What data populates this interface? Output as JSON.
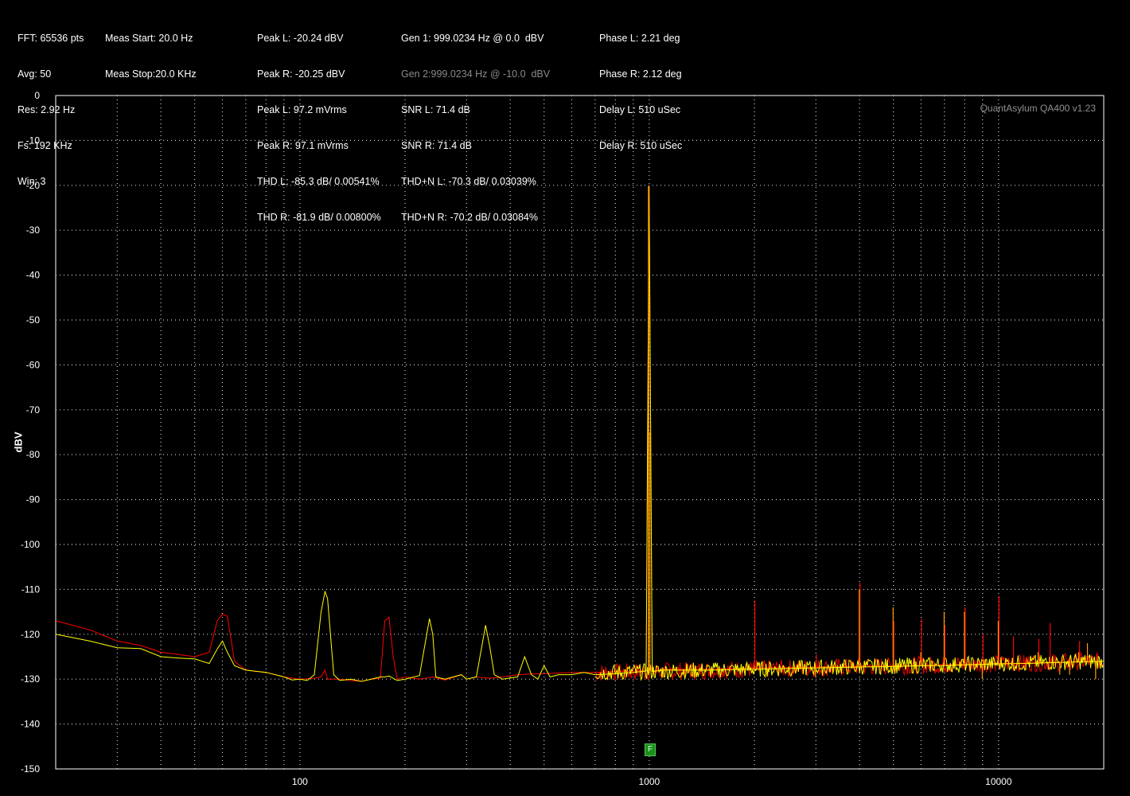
{
  "stats": {
    "col1": [
      "FFT: 65536 pts",
      "Avg: 50",
      "Res: 2.92 Hz",
      "Fs: 192 KHz",
      "Win: 3"
    ],
    "col2": [
      "Meas Start: 20.0 Hz",
      "Meas Stop:20.0 KHz"
    ],
    "col3": [
      "Peak L: -20.24 dBV",
      "Peak R: -20.25 dBV",
      "Peak L: 97.2 mVrms",
      "Peak R: 97.1 mVrms",
      "THD L: -85.3 dB/ 0.00541%",
      "THD R: -81.9 dB/ 0.00800%"
    ],
    "col4_gen1": "Gen 1: 999.0234 Hz @ 0.0  dBV",
    "col4_gen2": "Gen 2:999.0234 Hz @ -10.0  dBV",
    "col4": [
      "SNR L: 71.4 dB",
      "SNR R: 71.4 dB",
      "THD+N L: -70.3 dB/ 0.03039%",
      "THD+N R: -70.2 dB/ 0.03084%"
    ],
    "col5": [
      "Phase L: 2.21 deg",
      "Phase R: 2.12 deg",
      "Delay L: 510 uSec",
      "Delay R: 510 uSec"
    ]
  },
  "watermark": "QuantAsylum QA400 v1.23",
  "marker_label": "F",
  "colors": {
    "left": "#ffff00",
    "right": "#ff0000",
    "overlap": "#ff9d00",
    "grid": "#d0d0d0",
    "marker": "#1a8f1a"
  },
  "chart_data": {
    "type": "line",
    "x_scale": "log",
    "xlim": [
      20,
      20000
    ],
    "ylim": [
      -150,
      0
    ],
    "ylabel": "dBV",
    "xlabel": "",
    "x_ticks": [
      100,
      1000,
      10000
    ],
    "y_ticks": [
      0,
      -10,
      -20,
      -30,
      -40,
      -50,
      -60,
      -70,
      -80,
      -90,
      -100,
      -110,
      -120,
      -130,
      -140,
      -150
    ],
    "grid": true,
    "series": [
      {
        "name": "L",
        "color": "#ffff00",
        "x": [
          20,
          25,
          30,
          35,
          40,
          45,
          50,
          55,
          58,
          60,
          62,
          65,
          70,
          80,
          90,
          95,
          100,
          105,
          110,
          115,
          118,
          120,
          125,
          130,
          140,
          150,
          160,
          170,
          175,
          180,
          190,
          200,
          220,
          235,
          240,
          245,
          260,
          290,
          300,
          320,
          340,
          350,
          360,
          380,
          420,
          440,
          460,
          480,
          500,
          520,
          550,
          600,
          650,
          700,
          800,
          900,
          980,
          999,
          1020,
          1100,
          1500,
          2000,
          3000,
          4000,
          5000,
          6000,
          7000,
          8000,
          9000,
          10000,
          12000,
          15000,
          20000
        ],
        "y": [
          -120,
          -121.5,
          -123,
          -123.2,
          -125,
          -125.3,
          -125.5,
          -126.5,
          -123.3,
          -121.5,
          -124,
          -127,
          -128,
          -128.5,
          -129.5,
          -130.2,
          -130,
          -130.3,
          -129,
          -115,
          -110.5,
          -112,
          -129,
          -130.3,
          -130,
          -130.5,
          -130,
          -129.5,
          -129.5,
          -129.3,
          -130.3,
          -130,
          -129.2,
          -116.5,
          -120,
          -129.5,
          -130,
          -129,
          -130,
          -129.5,
          -118,
          -123,
          -129,
          -130,
          -129.5,
          -125,
          -129,
          -130,
          -127,
          -129.5,
          -129,
          -129,
          -128.5,
          -129,
          -128.8,
          -128.5,
          -128.2,
          -20.2,
          -128.3,
          -128,
          -128,
          -127.8,
          -127.5,
          -127.3,
          -127.2,
          -127,
          -127,
          -126.8,
          -126.7,
          -126.6,
          -126.5,
          -126.3,
          -126
        ]
      },
      {
        "name": "R",
        "color": "#ff0000",
        "x": [
          20,
          25,
          30,
          35,
          40,
          45,
          50,
          55,
          58,
          60,
          62,
          65,
          70,
          80,
          90,
          100,
          110,
          115,
          118,
          120,
          130,
          140,
          150,
          160,
          170,
          175,
          180,
          185,
          190,
          200,
          220,
          240,
          260,
          290,
          300,
          320,
          350,
          380,
          420,
          480,
          500,
          600,
          700,
          800,
          900,
          980,
          999,
          1020,
          1100,
          1500,
          2000,
          3000,
          4000,
          5000,
          6000,
          7000,
          8000,
          9000,
          10000,
          12000,
          15000,
          20000
        ],
        "y": [
          -117,
          -119,
          -121.5,
          -122.5,
          -124,
          -124.5,
          -125,
          -124,
          -117,
          -115.5,
          -116,
          -126,
          -128,
          -128.5,
          -129.5,
          -130,
          -129.8,
          -129.5,
          -128,
          -130,
          -130,
          -130.3,
          -130.5,
          -130,
          -129.8,
          -117,
          -116.2,
          -125,
          -130,
          -129.5,
          -130,
          -129.5,
          -130.2,
          -129,
          -130,
          -129.5,
          -129.8,
          -129.5,
          -129,
          -128.8,
          -128.8,
          -128.5,
          -128.5,
          -128.3,
          -128.2,
          -128.1,
          -20.25,
          -128.2,
          -127.8,
          -127.8,
          -127.5,
          -127.3,
          -127.2,
          -127,
          -127,
          -126.8,
          -126.7,
          -126.6,
          -126.5,
          -126.4,
          -126.2,
          -126
        ]
      }
    ],
    "harmonics": {
      "x": [
        2000,
        3000,
        4000,
        5000,
        6000,
        7000,
        8000,
        9000,
        10000,
        11000,
        12000,
        13000,
        14000,
        15000,
        16000,
        17000,
        18000,
        19000
      ],
      "L": [
        -127,
        -129.5,
        -110,
        -114,
        -124,
        -115,
        -115,
        -130,
        -117,
        -127,
        -128,
        -124,
        -125,
        -129,
        -129,
        -124,
        -122,
        -130
      ],
      "R": [
        -112.5,
        -124.5,
        -108.5,
        -117,
        -116.5,
        -118,
        -114,
        -120,
        -111.5,
        -120.5,
        -125,
        -121,
        -117.5,
        -127,
        -128,
        -121.5,
        -125,
        -124.5
      ]
    }
  }
}
